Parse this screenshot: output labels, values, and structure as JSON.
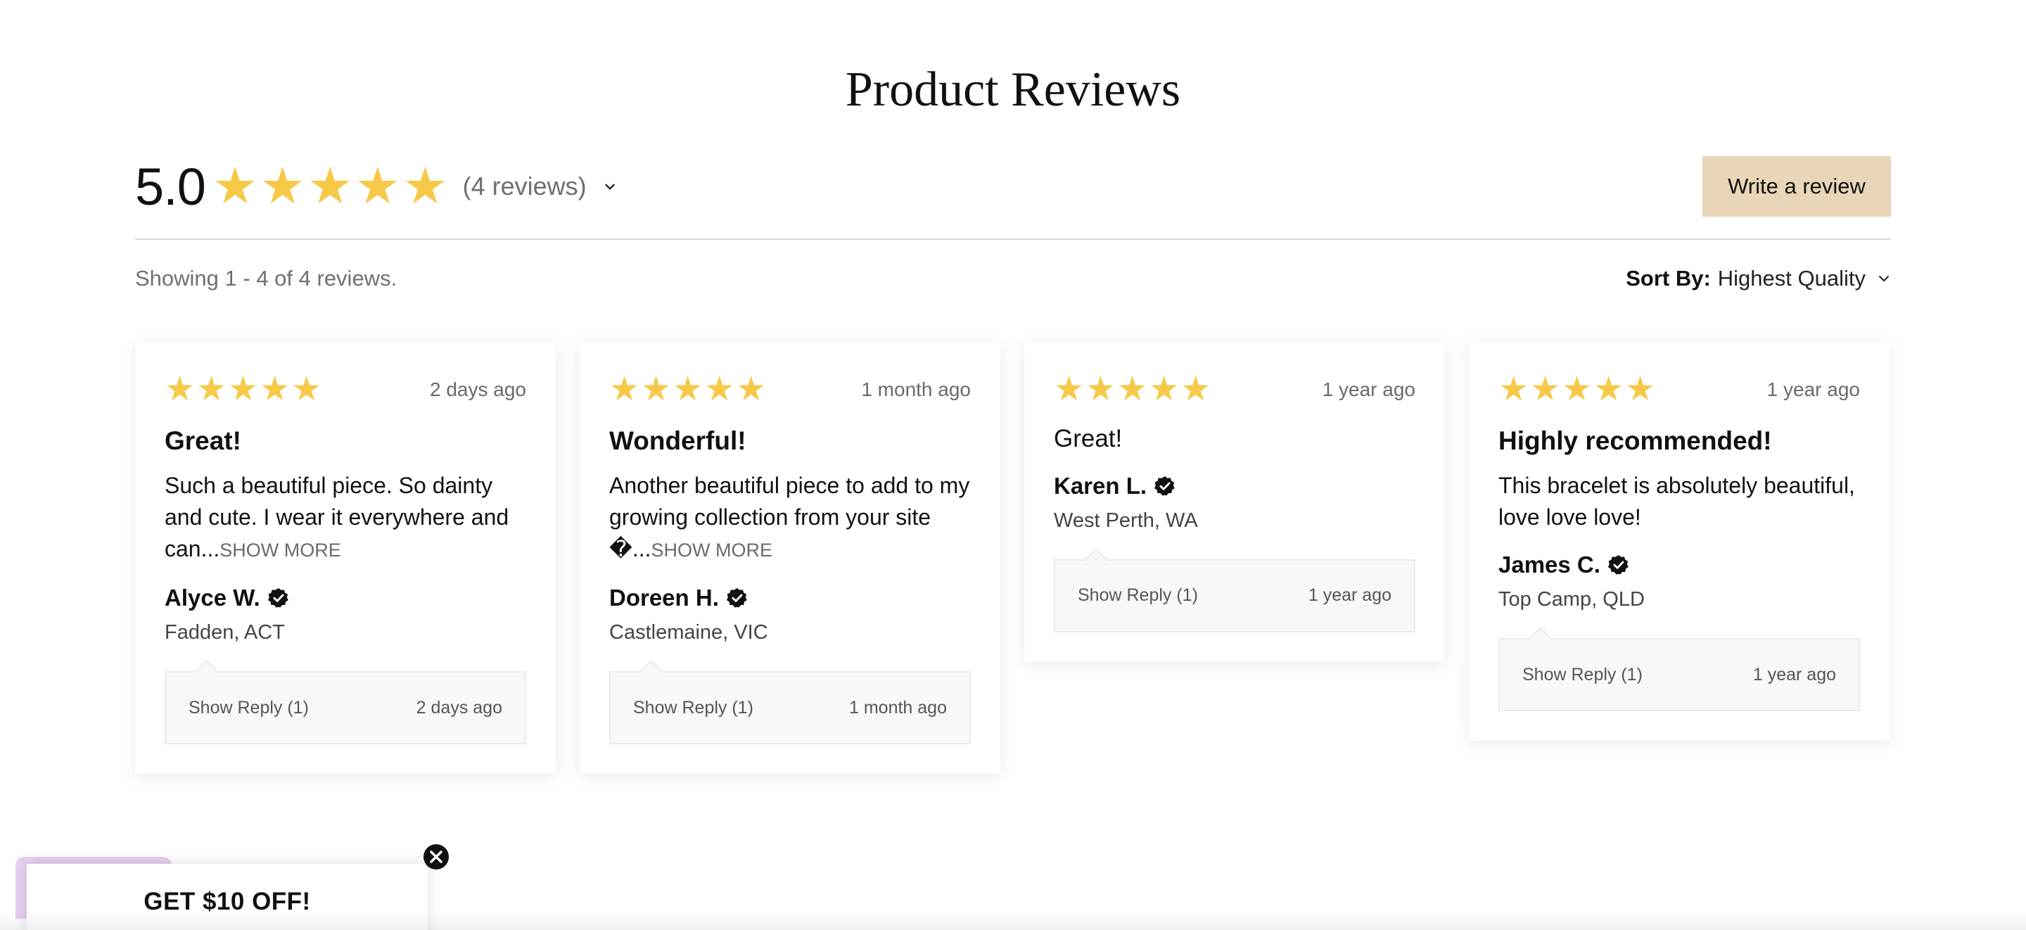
{
  "title": "Product Reviews",
  "summary": {
    "average": "5.0",
    "rating_out_of_5": 5,
    "count_label": "(4 reviews)"
  },
  "write_review_label": "Write a review",
  "showing_label": "Showing 1 - 4 of 4 reviews.",
  "sort": {
    "label": "Sort By:",
    "value": "Highest Quality"
  },
  "colors": {
    "star": "#F7C948",
    "button_bg": "#E9D5B7",
    "promo_tab": "#E6CFF0"
  },
  "reviews": [
    {
      "rating": 5,
      "date": "2 days ago",
      "title": "Great!",
      "body": "Such a beautiful piece. So dainty and cute. I wear it everywhere and can...",
      "show_more": "SHOW MORE",
      "author": "Alyce W.",
      "location": "Fadden, ACT",
      "reply_label": "Show Reply (1)",
      "reply_date": "2 days ago"
    },
    {
      "rating": 5,
      "date": "1 month ago",
      "title": "Wonderful!",
      "body": "Another beautiful piece to add to my growing collection from your site �...",
      "show_more": "SHOW MORE",
      "author": "Doreen H.",
      "location": "Castlemaine, VIC",
      "reply_label": "Show Reply (1)",
      "reply_date": "1 month ago"
    },
    {
      "rating": 5,
      "date": "1 year ago",
      "title": "Great!",
      "author": "Karen L.",
      "location": "West Perth, WA",
      "reply_label": "Show Reply (1)",
      "reply_date": "1 year ago"
    },
    {
      "rating": 5,
      "date": "1 year ago",
      "title": "Highly recommended!",
      "body": "This bracelet is absolutely beautiful, love love love!",
      "author": "James C.",
      "location": "Top Camp, QLD",
      "reply_label": "Show Reply (1)",
      "reply_date": "1 year ago"
    }
  ],
  "promo": {
    "text": "GET $10 OFF!"
  },
  "icons": {
    "star": "star-icon",
    "chevron": "chevron-down-icon",
    "verified": "verified-badge-icon",
    "close": "close-icon"
  }
}
